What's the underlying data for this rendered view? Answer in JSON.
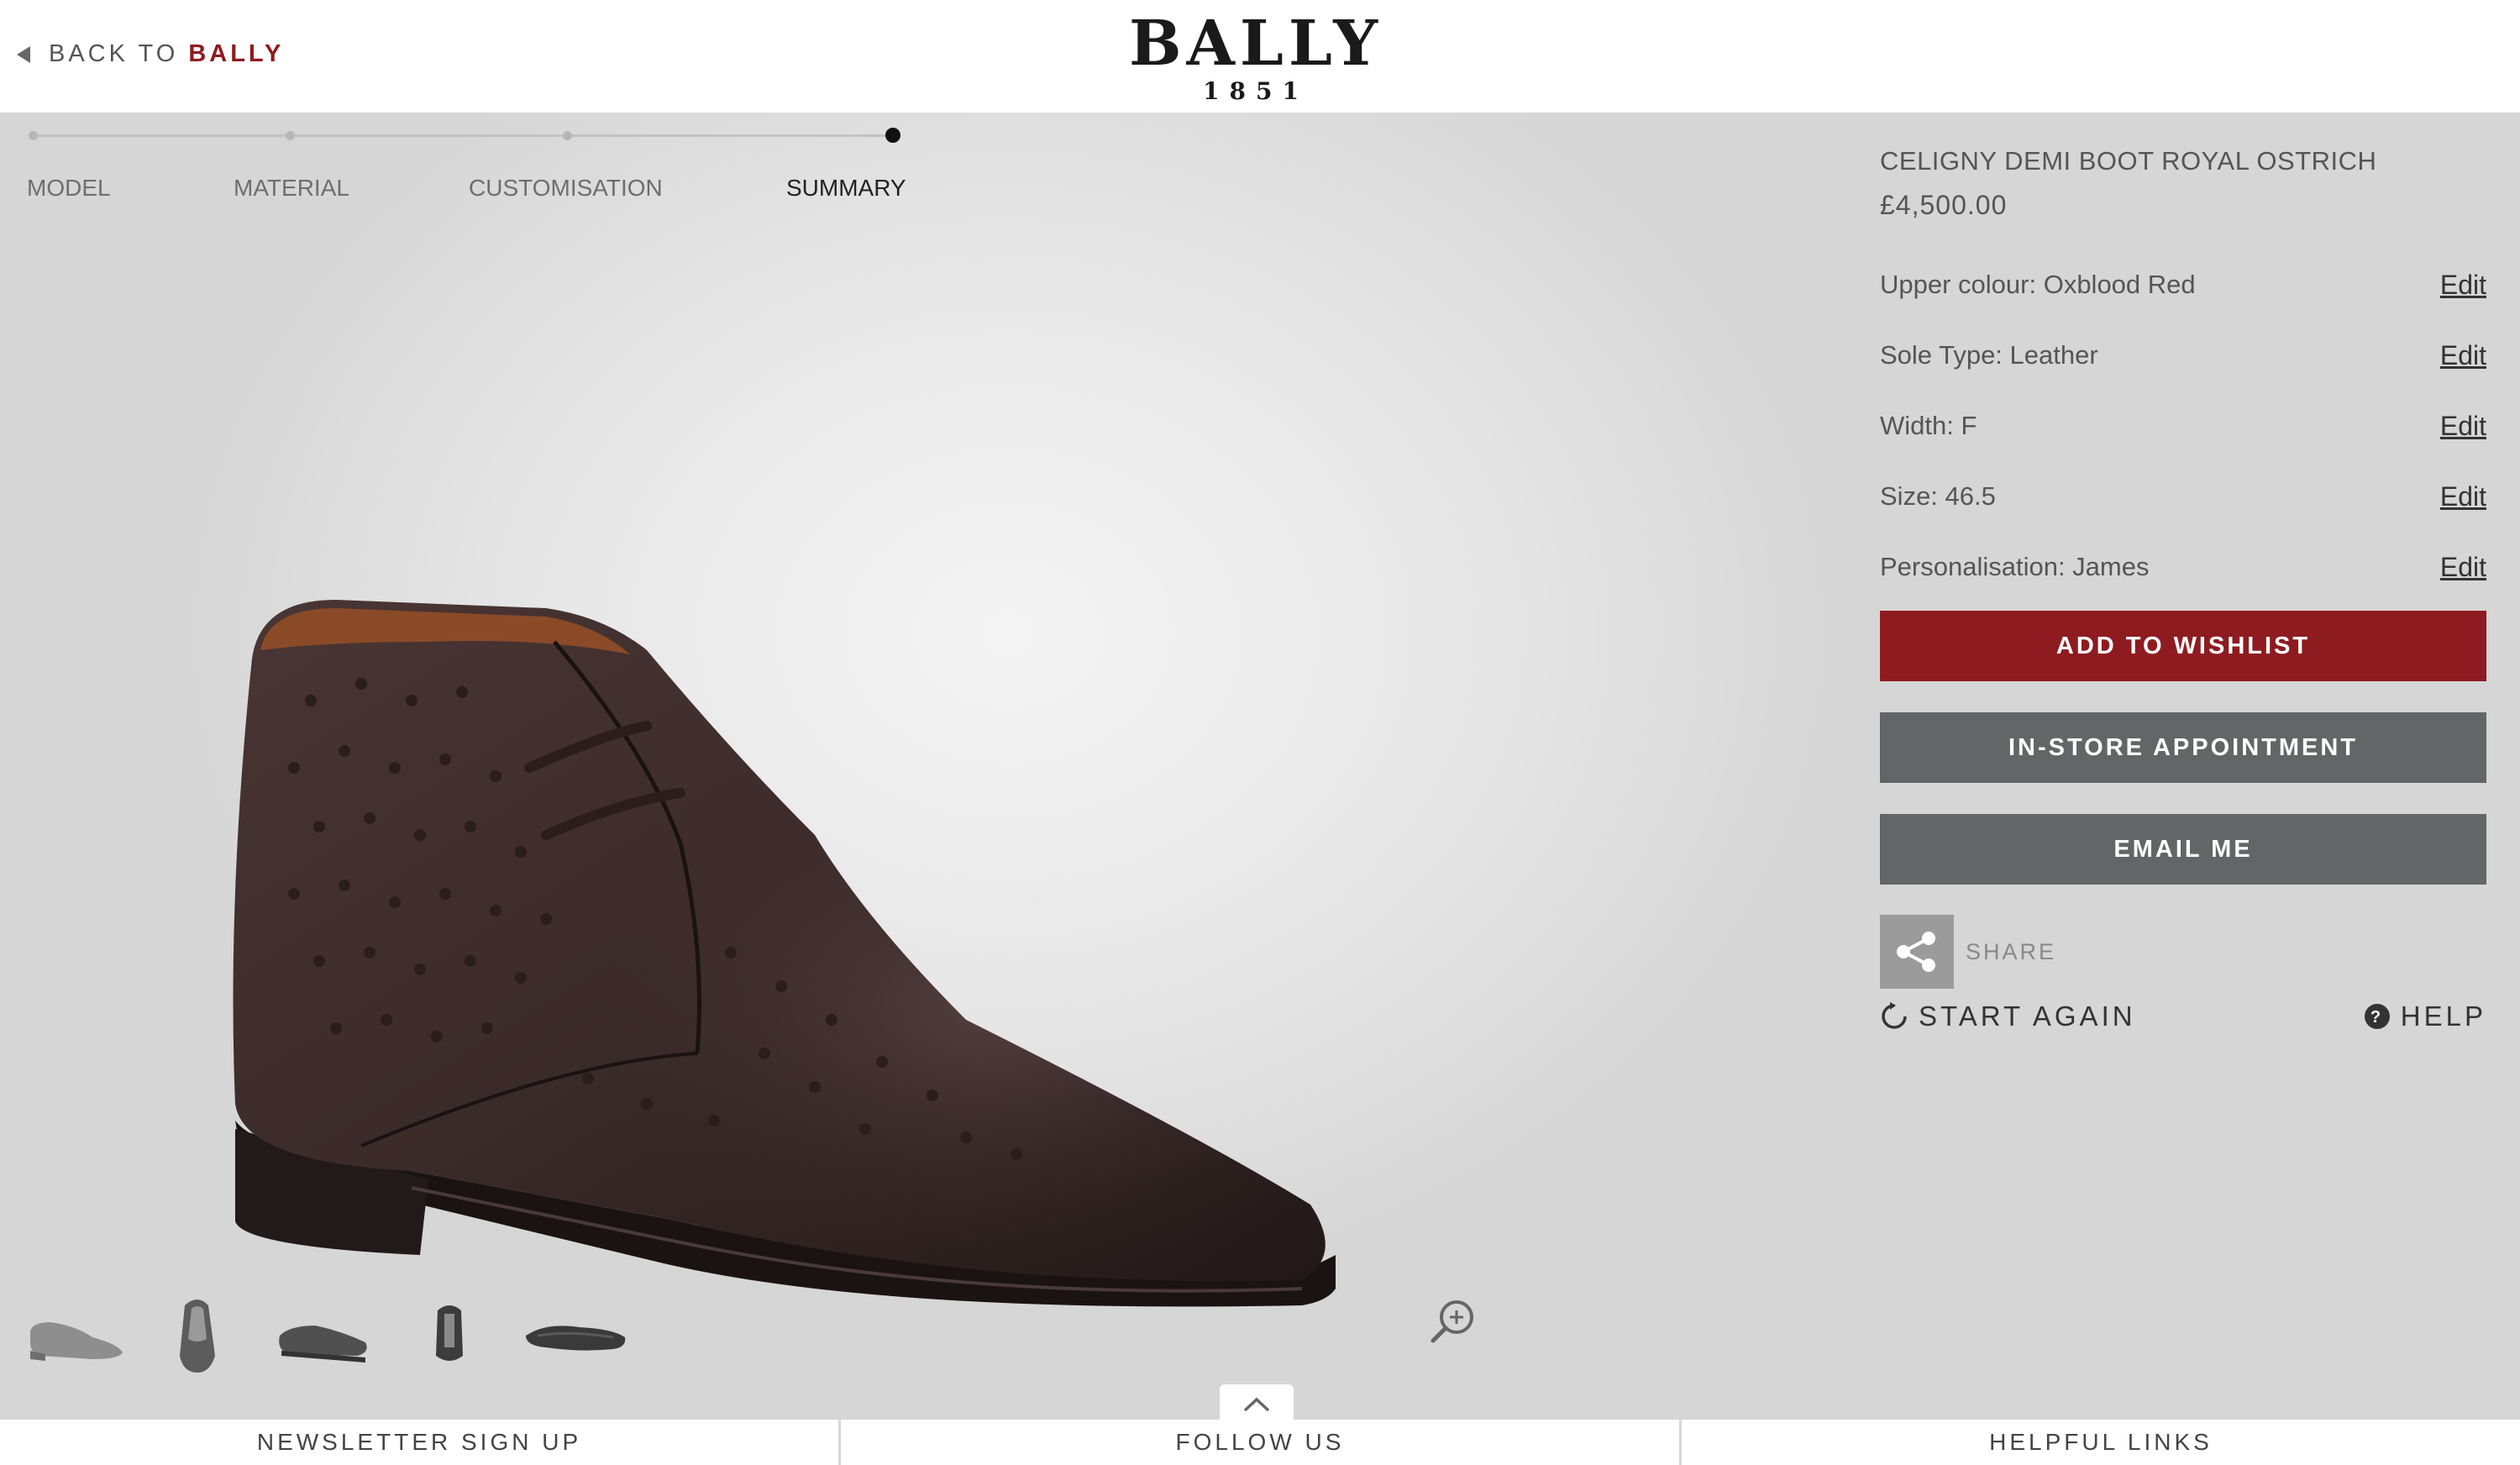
{
  "header": {
    "back_prefix": "BACK TO",
    "back_brand": "BALLY",
    "logo_name": "BALLY",
    "logo_year": "1851"
  },
  "steps": [
    {
      "label": "MODEL",
      "active": false
    },
    {
      "label": "MATERIAL",
      "active": false
    },
    {
      "label": "CUSTOMISATION",
      "active": false
    },
    {
      "label": "SUMMARY",
      "active": true
    }
  ],
  "product": {
    "name": "CELIGNY DEMI BOOT ROYAL OSTRICH",
    "price": "£4,500.00"
  },
  "options": [
    {
      "label": "Upper colour: Oxblood Red",
      "action": "Edit"
    },
    {
      "label": "Sole Type: Leather",
      "action": "Edit"
    },
    {
      "label": "Width: F",
      "action": "Edit"
    },
    {
      "label": "Size: 46.5",
      "action": "Edit"
    },
    {
      "label": "Personalisation: James",
      "action": "Edit"
    }
  ],
  "buttons": {
    "wishlist": "ADD TO WISHLIST",
    "appointment": "IN-STORE APPOINTMENT",
    "email": "EMAIL ME"
  },
  "share": {
    "label": "SHARE",
    "icon": "share-icon"
  },
  "actions": {
    "start_again": "START AGAIN",
    "help": "HELP"
  },
  "thumbnails": [
    {
      "name": "side-view"
    },
    {
      "name": "front-view"
    },
    {
      "name": "three-quarter-view"
    },
    {
      "name": "back-view"
    },
    {
      "name": "sole-view"
    }
  ],
  "footer": {
    "newsletter": "NEWSLETTER SIGN UP",
    "follow": "FOLLOW US",
    "links": "HELPFUL LINKS"
  },
  "colors": {
    "accent": "#8e1b1f",
    "button_grey": "#636566",
    "boot": "#3a2a28"
  }
}
